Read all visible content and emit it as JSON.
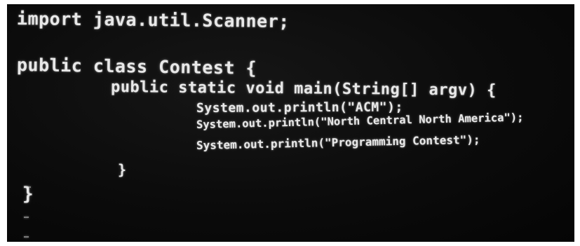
{
  "code_lines": [
    "import java.util.Scanner;",
    "public class Contest {",
    "public static void main(String[] argv) {",
    "System.out.println(\"ACM\");",
    "System.out.println(\"North Central North America\");",
    "System.out.println(\"Programming Contest\");",
    "}",
    "}"
  ],
  "colors": {
    "background": "#0b0b0b",
    "text": "#e8e8e8"
  }
}
